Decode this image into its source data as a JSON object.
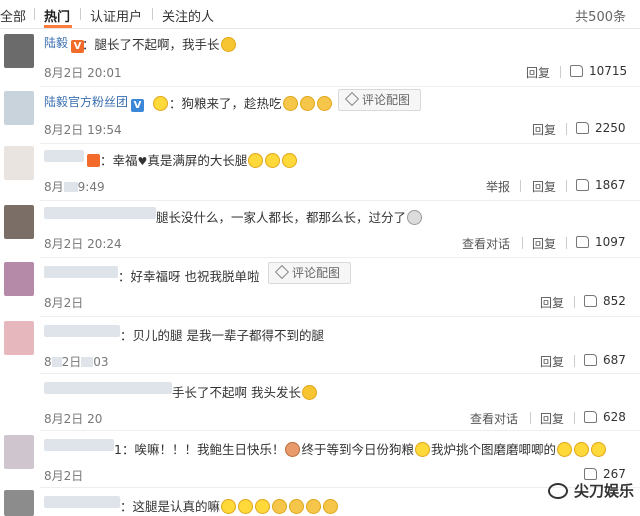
{
  "tabs": [
    "全部",
    "热门",
    "认证用户",
    "关注的人"
  ],
  "total": "共500条",
  "comments": [
    {
      "name": "陆毅",
      "badge": "V",
      "text": "：腿长了不起啊，我手长",
      "time": "8月2日 20:01",
      "actions": [
        "回复"
      ],
      "likes": "10715"
    },
    {
      "name": "陆毅官方粉丝团",
      "badge": "V",
      "text": "：狗粮来了，趁热吃",
      "tag": "评论配图",
      "time": "8月2日 19:54",
      "actions": [
        "回复"
      ],
      "likes": "2250"
    },
    {
      "text": "：幸福",
      "text2": "真是满屏的大长腿",
      "time_prefix": "8月",
      "time_suffix": "9:49",
      "actions": [
        "举报",
        "回复"
      ],
      "likes": "1867"
    },
    {
      "text": "腿长没什么，一家人都长，都那么长，过分了",
      "time": "8月2日 20:24",
      "actions": [
        "查看对话",
        "回复"
      ],
      "likes": "1097"
    },
    {
      "text": "：好幸福呀 也祝我脱单啦",
      "tag": "评论配图",
      "time": "8月2日",
      "actions": [
        "回复"
      ],
      "likes": "852"
    },
    {
      "text": "：贝儿的腿 是我一辈子都得不到的腿",
      "time_prefix": "8",
      "time_suffix": "2日",
      "time_end": "03",
      "actions": [
        "回复"
      ],
      "likes": "687"
    },
    {
      "text": "手长了不起啊 我头发长",
      "time": "8月2日 20",
      "actions": [
        "查看对话",
        "回复"
      ],
      "likes": "628"
    },
    {
      "text": "1：唉嘛！！！我鲍生日快乐！",
      "text2": "终于等到今日份狗粮",
      "text3": "我炉挑个图磨磨唧唧的",
      "time": "8月2日",
      "actions": [
        "回复"
      ],
      "likes": "267"
    },
    {
      "text": "：这腿是认真的嘛"
    }
  ],
  "watermark": "尖刀娱乐",
  "colors": {
    "accent": "#fa7d3c",
    "link": "#3a6fb0",
    "badge_orange": "#f26b2a",
    "badge_blue": "#3b87d8"
  }
}
